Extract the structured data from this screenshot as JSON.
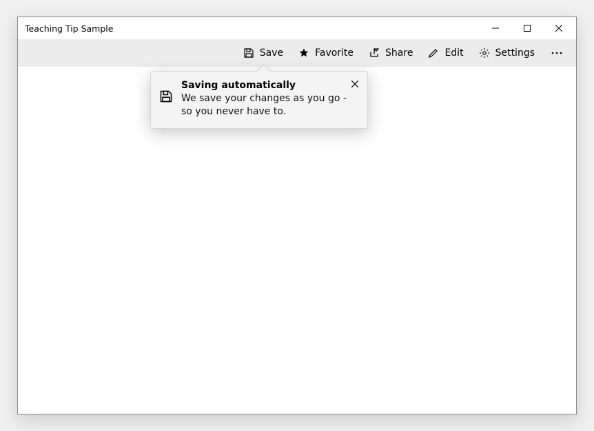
{
  "window": {
    "title": "Teaching Tip Sample"
  },
  "toolbar": {
    "save_label": "Save",
    "favorite_label": "Favorite",
    "share_label": "Share",
    "edit_label": "Edit",
    "settings_label": "Settings"
  },
  "teaching_tip": {
    "title": "Saving automatically",
    "body": "We save your changes as you go - so you never have to."
  }
}
